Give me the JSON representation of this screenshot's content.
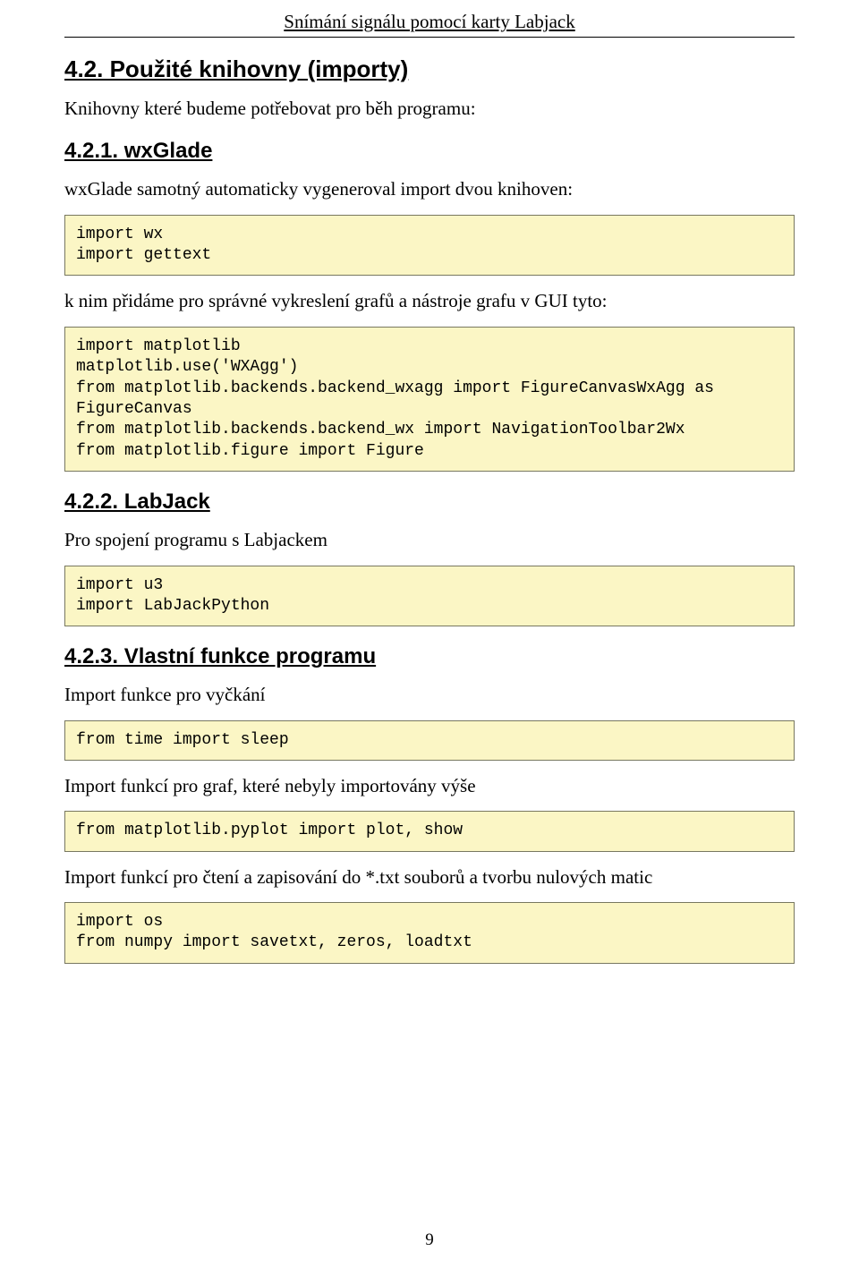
{
  "header": {
    "running_title": "Snímání signálu pomocí karty Labjack"
  },
  "sections": {
    "s42": {
      "heading": "4.2. Použité knihovny (importy)",
      "intro": "Knihovny které budeme potřebovat pro běh programu:"
    },
    "s421": {
      "heading": "4.2.1. wxGlade",
      "p1": "wxGlade samotný automaticky vygeneroval import dvou knihoven:",
      "code1": "import wx\nimport gettext",
      "p2": "k nim přidáme pro správné vykreslení grafů a nástroje grafu v GUI tyto:",
      "code2": "import matplotlib\nmatplotlib.use('WXAgg')\nfrom matplotlib.backends.backend_wxagg import FigureCanvasWxAgg as\nFigureCanvas\nfrom matplotlib.backends.backend_wx import NavigationToolbar2Wx\nfrom matplotlib.figure import Figure"
    },
    "s422": {
      "heading": "4.2.2. LabJack",
      "p1": "Pro spojení programu s Labjackem",
      "code1": "import u3\nimport LabJackPython"
    },
    "s423": {
      "heading": "4.2.3. Vlastní funkce programu",
      "p1": "Import funkce pro vyčkání",
      "code1": "from time import sleep",
      "p2": "Import funkcí pro graf, které nebyly importovány výše",
      "code2": "from matplotlib.pyplot import plot, show",
      "p3": "Import funkcí pro čtení a zapisování do *.txt souborů a tvorbu nulových matic",
      "code3": "import os\nfrom numpy import savetxt, zeros, loadtxt"
    }
  },
  "footer": {
    "page_number": "9"
  }
}
